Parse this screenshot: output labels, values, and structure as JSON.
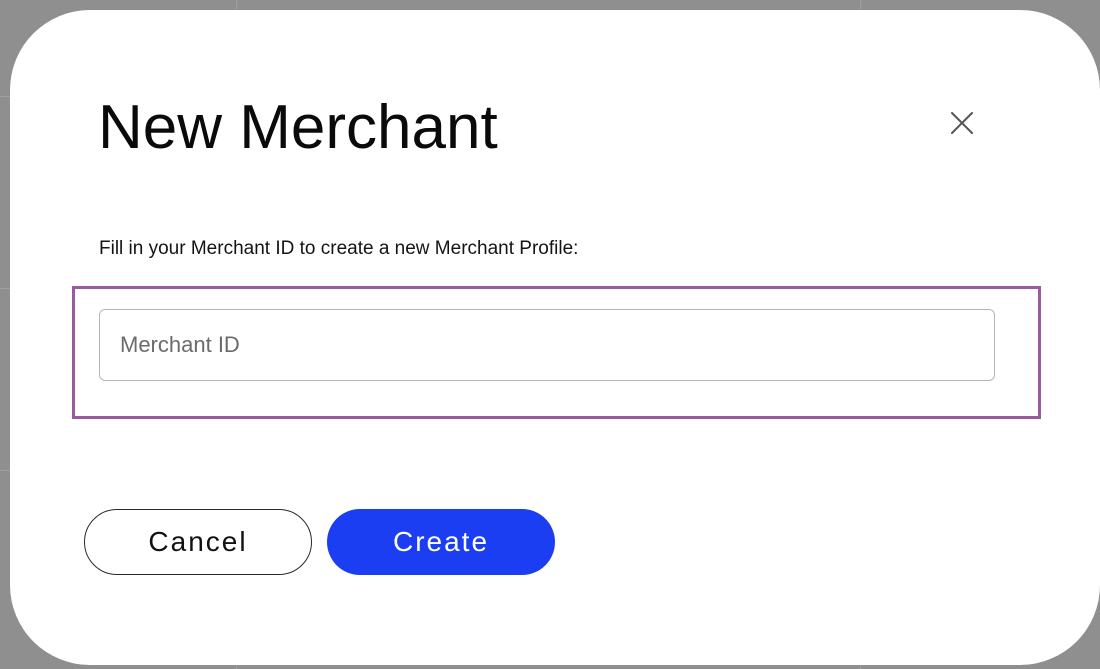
{
  "modal": {
    "title": "New Merchant",
    "close_icon": "close-icon",
    "instructions": "Fill in your Merchant ID to create a new Merchant Profile:",
    "merchant_id_input": {
      "value": "",
      "placeholder": "Merchant ID"
    },
    "buttons": {
      "cancel_label": "Cancel",
      "create_label": "Create"
    }
  },
  "colors": {
    "backdrop": "#8f8f8f",
    "modal_background": "#ffffff",
    "primary_button": "#1c3ef2",
    "highlight_frame": "#9a5a9e"
  }
}
